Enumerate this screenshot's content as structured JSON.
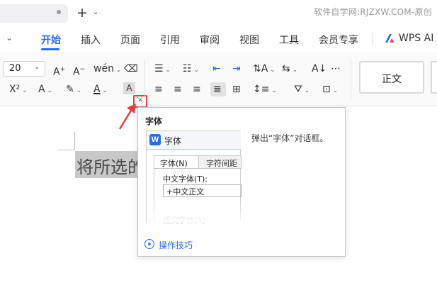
{
  "titlebar": {
    "watermark": "软件自学网:RJZXW.COM-原创",
    "new_tab_label": "+"
  },
  "menu": {
    "items": [
      {
        "label": "开始",
        "active": true
      },
      {
        "label": "插入"
      },
      {
        "label": "页面"
      },
      {
        "label": "引用"
      },
      {
        "label": "审阅"
      },
      {
        "label": "视图"
      },
      {
        "label": "工具"
      },
      {
        "label": "会员专享"
      },
      {
        "label": "WPS AI"
      }
    ]
  },
  "ribbon": {
    "font_size": "20",
    "style_gallery_first": "正文"
  },
  "document": {
    "selected_text": "将所选的"
  },
  "tooltip": {
    "title": "字体",
    "description": "弹出“字体”对话框。",
    "preview": {
      "dialog_title": "字体",
      "tab_font": "字体(N)",
      "tab_spacing": "字符间距",
      "chinese_font_label": "中文字体(T):",
      "chinese_font_value": "+中文正文",
      "western_font_label": "西文字体(X):"
    },
    "tips_link": "操作技巧"
  },
  "colors": {
    "accent": "#2b6be6",
    "highlight_box": "#e34040",
    "selection": "#c8c8c8"
  }
}
